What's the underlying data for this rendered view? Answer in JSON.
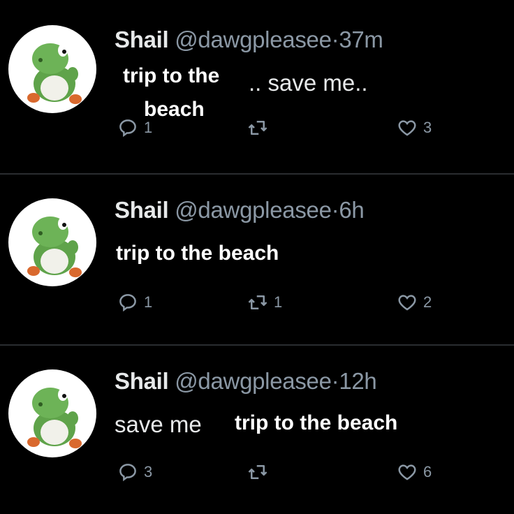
{
  "tweets": [
    {
      "name": "Shail",
      "handle": "@dawgpleasee",
      "separator": "·",
      "time": "37m",
      "overlay_text_line1": "trip to the",
      "overlay_text_line2": "beach",
      "original_text": ".. save me..",
      "replies": "1",
      "retweets": "",
      "likes": "3"
    },
    {
      "name": "Shail",
      "handle": "@dawgpleasee",
      "separator": "·",
      "time": "6h",
      "overlay_text": "trip to the beach",
      "replies": "1",
      "retweets": "1",
      "likes": "2"
    },
    {
      "name": "Shail",
      "handle": "@dawgpleasee",
      "separator": "·",
      "time": "12h",
      "original_text": "save me",
      "overlay_text": "trip to the beach",
      "replies": "3",
      "retweets": "",
      "likes": "6"
    }
  ],
  "icons": {
    "reply": "reply-icon",
    "retweet": "retweet-icon",
    "like": "heart-icon",
    "avatar": "yoshi-avatar"
  }
}
